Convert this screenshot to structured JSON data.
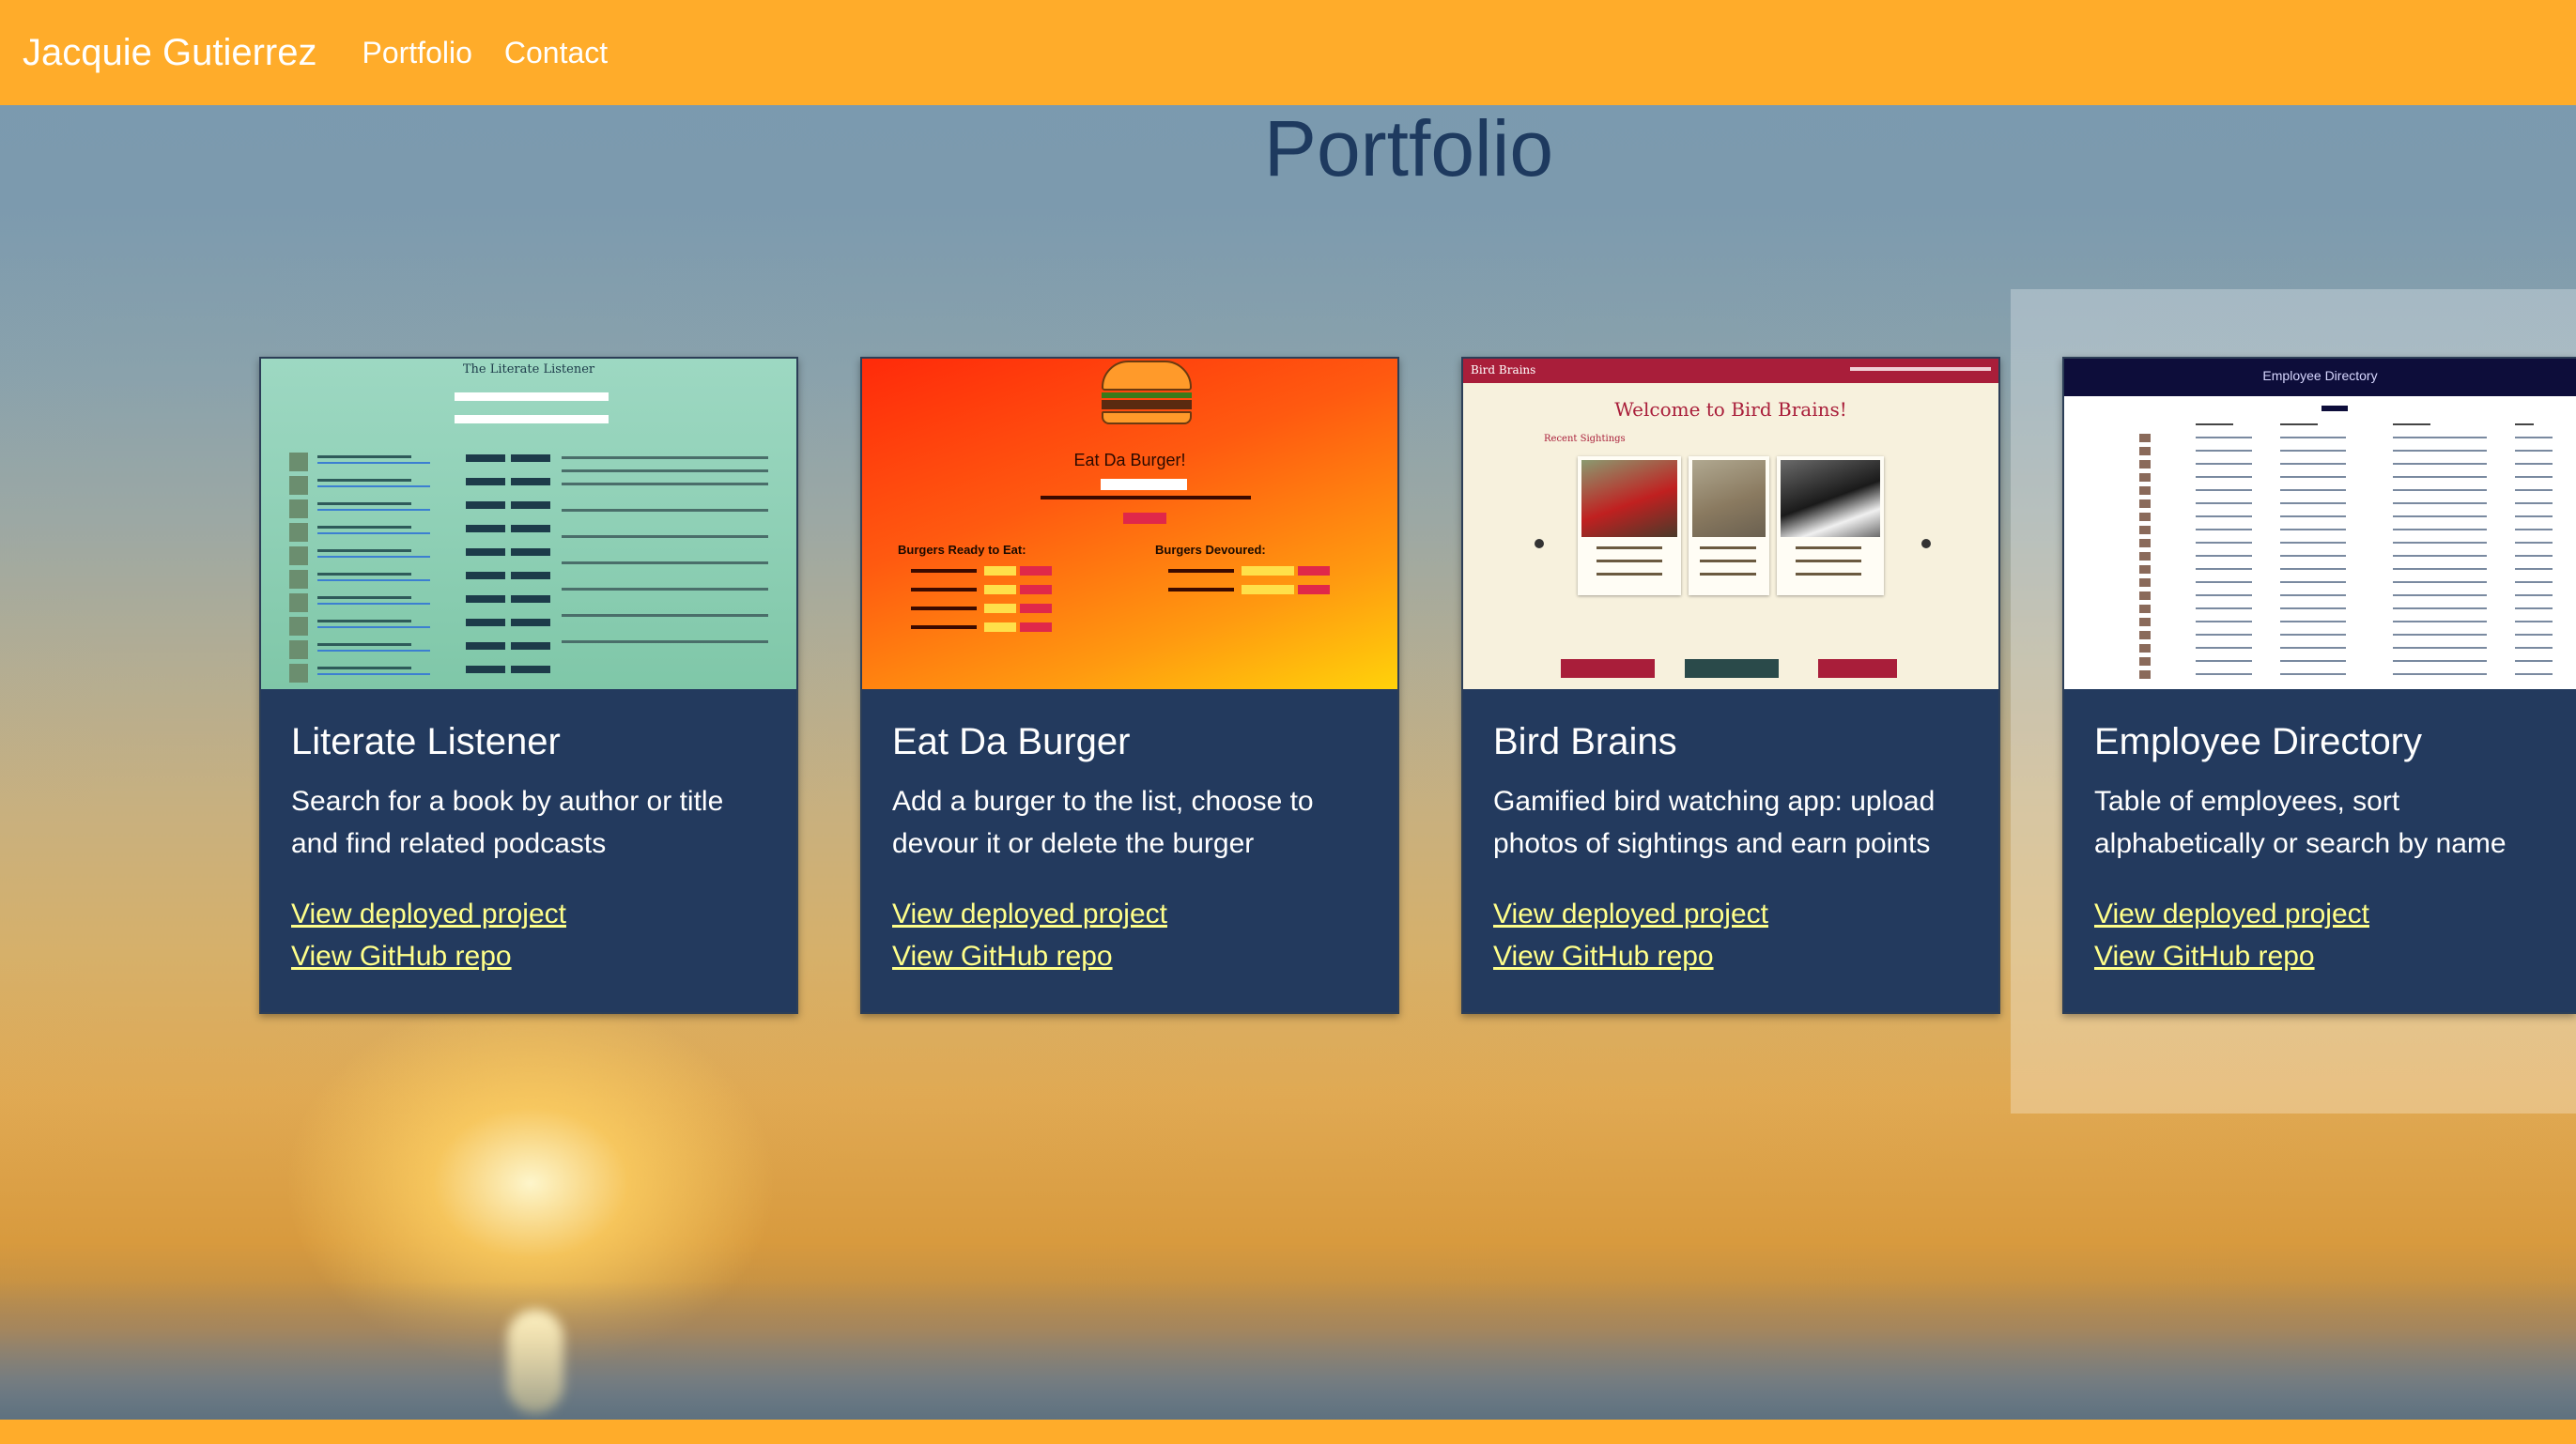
{
  "navbar": {
    "brand": "Jacquie Gutierrez",
    "links": [
      "Portfolio",
      "Contact"
    ]
  },
  "page": {
    "title": "Portfolio"
  },
  "projects": [
    {
      "title": "Literate Listener",
      "description": "Search for a book by author or title and find related podcasts",
      "deployed_link": "View deployed project",
      "repo_link": "View GitHub repo",
      "thumbnail": {
        "heading": "The Literate Listener"
      }
    },
    {
      "title": "Eat Da Burger",
      "description": "Add a burger to the list, choose to devour it or delete the burger",
      "deployed_link": "View deployed project",
      "repo_link": "View GitHub repo",
      "thumbnail": {
        "heading": "Eat Da Burger!",
        "ready_heading": "Burgers Ready to Eat:",
        "devoured_heading": "Burgers Devoured:"
      }
    },
    {
      "title": "Bird Brains",
      "description": "Gamified bird watching app: upload photos of sightings and earn points",
      "deployed_link": "View deployed project",
      "repo_link": "View GitHub repo",
      "thumbnail": {
        "logo": "Bird Brains",
        "heading": "Welcome to Bird Brains!",
        "subheading": "Recent Sightings"
      }
    },
    {
      "title": "Employee Directory",
      "description": "Table of employees, sort alphabetically or search by name",
      "deployed_link": "View deployed project",
      "repo_link": "View GitHub repo",
      "thumbnail": {
        "heading": "Employee Directory"
      }
    }
  ],
  "colors": {
    "navbar": "#ffac2a",
    "card": "#233a5e",
    "link": "#ffff8a",
    "title": "#1e3a5f"
  }
}
